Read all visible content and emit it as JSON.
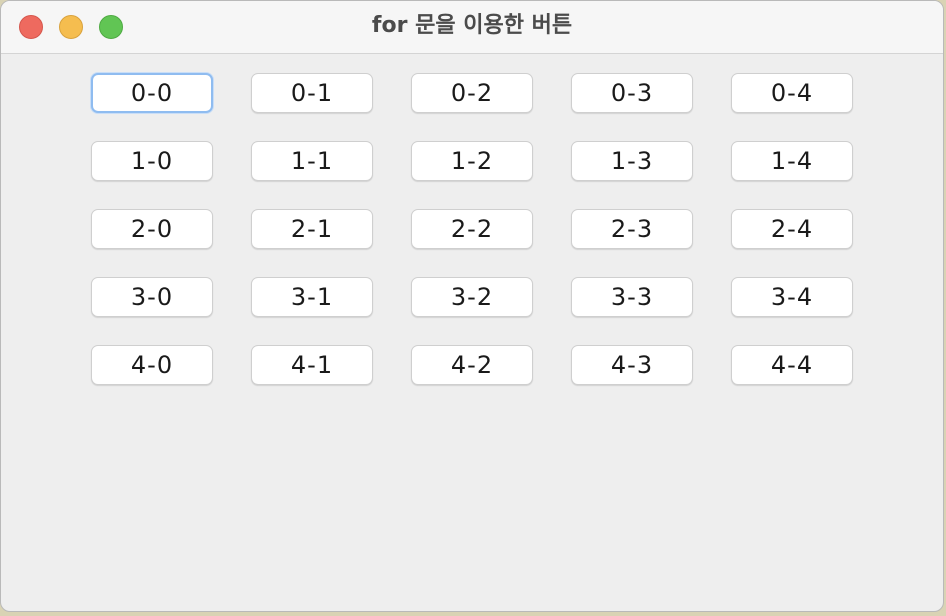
{
  "window": {
    "title": "for 문을 이용한 버튼",
    "focused_button": "0-0"
  },
  "buttons": [
    [
      "0-0",
      "0-1",
      "0-2",
      "0-3",
      "0-4"
    ],
    [
      "1-0",
      "1-1",
      "1-2",
      "1-3",
      "1-4"
    ],
    [
      "2-0",
      "2-1",
      "2-2",
      "2-3",
      "2-4"
    ],
    [
      "3-0",
      "3-1",
      "3-2",
      "3-3",
      "3-4"
    ],
    [
      "4-0",
      "4-1",
      "4-2",
      "4-3",
      "4-4"
    ]
  ],
  "colors": {
    "close": "#ee6a5f",
    "minimize": "#f5bd4f",
    "zoom": "#61c554",
    "focus_ring": "#8fbcf0"
  }
}
